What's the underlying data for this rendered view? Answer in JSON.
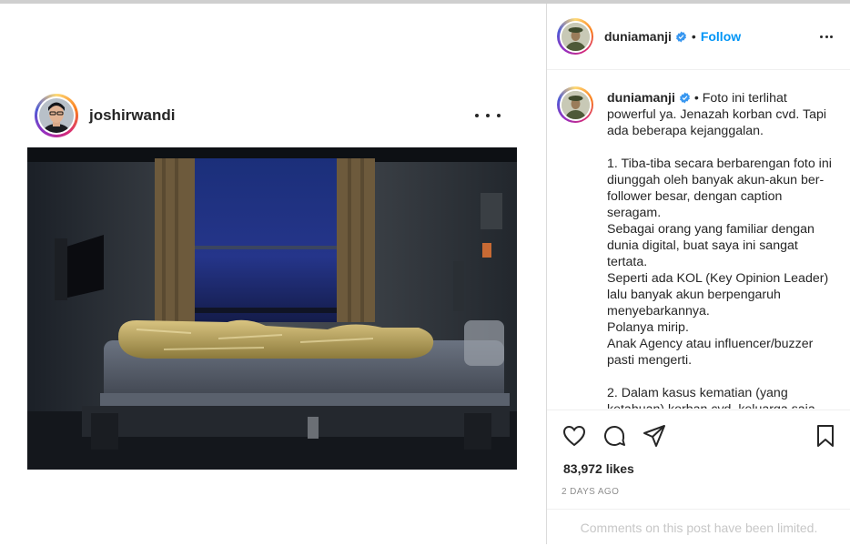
{
  "embed": {
    "username": "joshirwandi"
  },
  "post": {
    "author": "duniamanji",
    "follow_label": "Follow",
    "separator": "•",
    "caption_author": "duniamanji",
    "caption_body": " • Foto ini terlihat powerful ya. Jenazah korban cvd. Tapi ada beberapa kejanggalan.\n\n1. Tiba-tiba secara berbarengan foto ini diunggah oleh banyak akun-akun ber-follower besar, dengan caption seragam.\nSebagai orang yang familiar dengan dunia digital, buat saya ini sangat tertata.\nSeperti ada KOL (Key Opinion Leader) lalu banyak akun berpengaruh menyebarkannya.\nPolanya mirip.\nAnak Agency atau influencer/buzzer pasti mengerti.\n\n2. Dalam kasus kematian (yang ketahuan) korban cvd, keluarga saja",
    "likes": "83,972 likes",
    "time": "2 DAYS AGO",
    "comments_limited": "Comments on this post have been limited."
  },
  "icons": {
    "like": "heart-icon",
    "comment": "comment-icon",
    "share": "share-icon",
    "save": "bookmark-icon",
    "more": "more-icon",
    "verified": "verified-badge-icon"
  },
  "colors": {
    "link": "#0095f6",
    "verified": "#3897f0",
    "muted": "#8e8e8e",
    "text": "#262626"
  }
}
